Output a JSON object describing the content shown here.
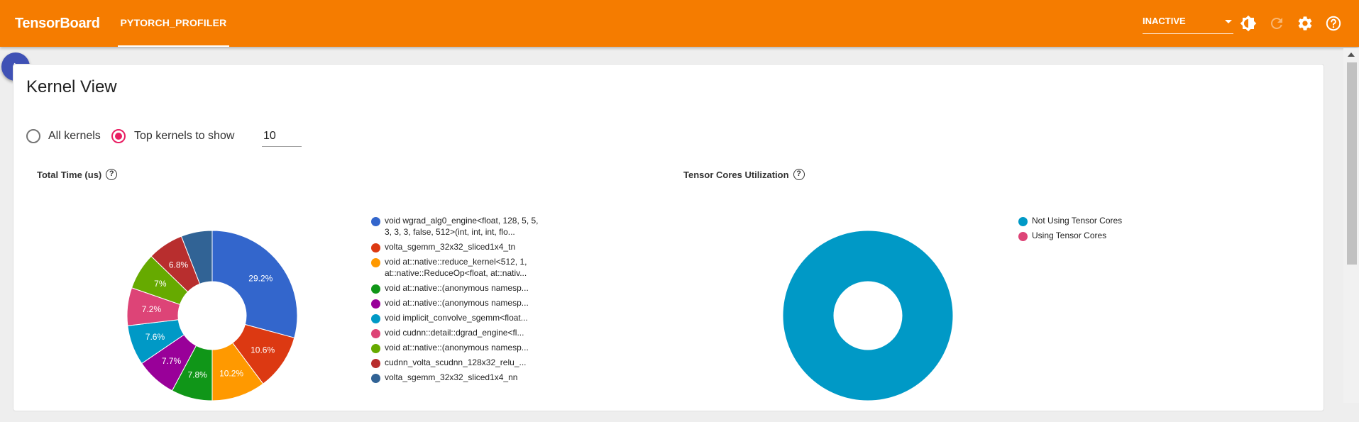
{
  "header": {
    "brand": "TensorBoard",
    "plugin_tab": "PYTORCH_PROFILER",
    "run_status": "INACTIVE",
    "icons": [
      "brightness-icon",
      "refresh-icon",
      "settings-icon",
      "help-icon"
    ]
  },
  "view": {
    "title": "Kernel View",
    "all_kernels_label": "All kernels",
    "top_kernels_label": "Top kernels to show",
    "top_kernels_value": "10",
    "selected_option": "top_kernels"
  },
  "total_time": {
    "title": "Total Time (us)"
  },
  "tensor_cores": {
    "title": "Tensor Cores Utilization"
  },
  "chart_data": [
    {
      "type": "pie",
      "title": "Total Time (us)",
      "legend_position": "right",
      "slices": [
        {
          "label": "void wgrad_alg0_engine<float, 128, 5, 5, 3, 3, 3, false, 512>(int, int, int, flo...",
          "value": 29.2,
          "color": "#3366cc",
          "display": "29.2%"
        },
        {
          "label": "volta_sgemm_32x32_sliced1x4_tn",
          "value": 10.6,
          "color": "#dc3912",
          "display": "10.6%"
        },
        {
          "label": "void at::native::reduce_kernel<512, 1, at::native::ReduceOp<float, at::nativ...",
          "value": 10.2,
          "color": "#ff9900",
          "display": "10.2%"
        },
        {
          "label": "void at::native::(anonymous namesp...",
          "value": 7.8,
          "color": "#109618",
          "display": "7.8%"
        },
        {
          "label": "void at::native::(anonymous namesp...",
          "value": 7.7,
          "color": "#990099",
          "display": "7.7%"
        },
        {
          "label": "void implicit_convolve_sgemm<float...",
          "value": 7.6,
          "color": "#0099c6",
          "display": "7.6%"
        },
        {
          "label": "void cudnn::detail::dgrad_engine<fl...",
          "value": 7.2,
          "color": "#dd4477",
          "display": "7.2%"
        },
        {
          "label": "void at::native::(anonymous namesp...",
          "value": 7.0,
          "color": "#66aa00",
          "display": "7%"
        },
        {
          "label": "cudnn_volta_scudnn_128x32_relu_...",
          "value": 6.8,
          "color": "#b82e2e",
          "display": "6.8%"
        },
        {
          "label": "volta_sgemm_32x32_sliced1x4_nn",
          "value": 5.9,
          "color": "#316395",
          "display": ""
        }
      ]
    },
    {
      "type": "pie",
      "title": "Tensor Cores Utilization",
      "legend_position": "right",
      "slices": [
        {
          "label": "Not Using Tensor Cores",
          "value": 100,
          "color": "#0099c6",
          "display": ""
        },
        {
          "label": "Using Tensor Cores",
          "value": 0,
          "color": "#dd4477",
          "display": ""
        }
      ]
    }
  ]
}
